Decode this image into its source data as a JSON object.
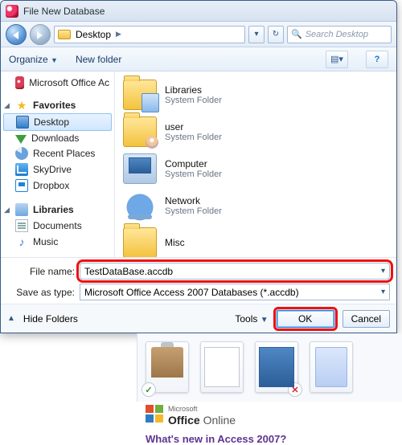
{
  "dialog": {
    "title": "File New Database",
    "breadcrumb": {
      "location": "Desktop"
    },
    "search_placeholder": "Search Desktop",
    "toolbar": {
      "organize": "Organize",
      "new_folder": "New folder"
    }
  },
  "navpane": {
    "access": "Microsoft Office Ac",
    "favorites_header": "Favorites",
    "favorites": [
      {
        "key": "desktop",
        "label": "Desktop",
        "selected": true
      },
      {
        "key": "downloads",
        "label": "Downloads"
      },
      {
        "key": "recent",
        "label": "Recent Places"
      },
      {
        "key": "skydrive",
        "label": "SkyDrive"
      },
      {
        "key": "dropbox",
        "label": "Dropbox"
      }
    ],
    "libraries_header": "Libraries",
    "libraries": [
      {
        "key": "documents",
        "label": "Documents"
      },
      {
        "key": "music",
        "label": "Music"
      }
    ]
  },
  "content": {
    "items": [
      {
        "name": "Libraries",
        "sub": "System Folder",
        "icon": "lib"
      },
      {
        "name": "user",
        "sub": "System Folder",
        "icon": "user"
      },
      {
        "name": "Computer",
        "sub": "System Folder",
        "icon": "computer"
      },
      {
        "name": "Network",
        "sub": "System Folder",
        "icon": "network"
      },
      {
        "name": "Misc",
        "sub": "",
        "icon": "folder"
      }
    ]
  },
  "fields": {
    "filename_label": "File name:",
    "filename_value": "TestDataBase.accdb",
    "savetype_label": "Save as type:",
    "savetype_value": "Microsoft Office Access 2007 Databases (*.accdb)"
  },
  "footer": {
    "hide_folders": "Hide Folders",
    "tools": "Tools",
    "ok": "OK",
    "cancel": "Cancel"
  },
  "under": {
    "office_brand_strong": "Office",
    "office_brand_light": " Online",
    "office_prefix": "Microsoft",
    "whatsnew": "What's new in Access 2007?"
  }
}
